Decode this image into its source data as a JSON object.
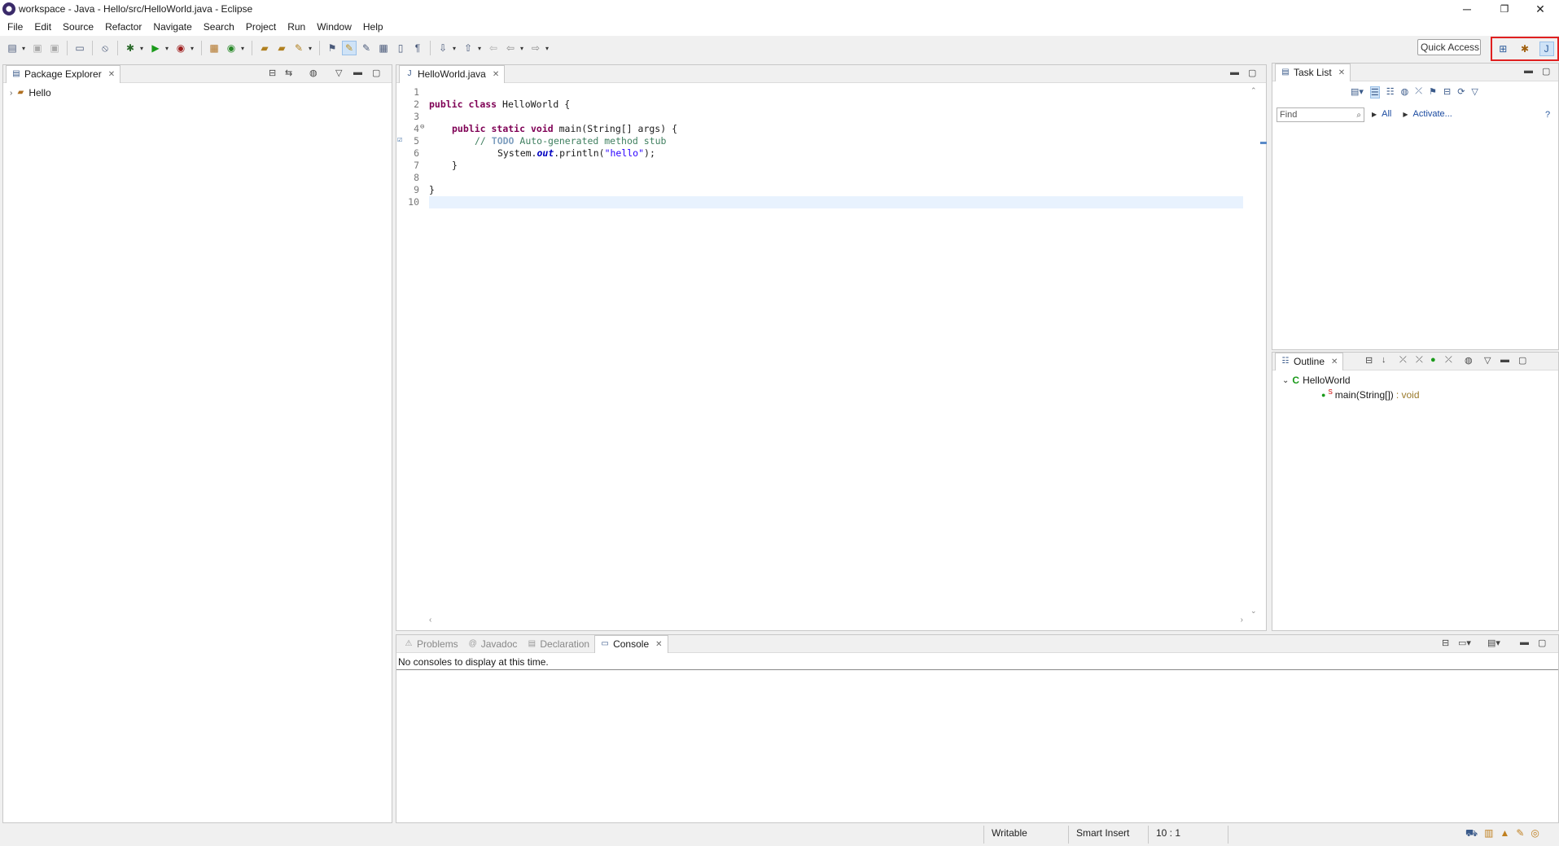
{
  "window": {
    "title": "workspace - Java - Hello/src/HelloWorld.java - Eclipse",
    "minimize": "─",
    "restore": "❐",
    "close": "✕"
  },
  "menu": [
    "File",
    "Edit",
    "Source",
    "Refactor",
    "Navigate",
    "Search",
    "Project",
    "Run",
    "Window",
    "Help"
  ],
  "toolbar": {
    "quick_access": "Quick Access"
  },
  "package_explorer": {
    "tab_label": "Package Explorer",
    "projects": [
      "Hello"
    ]
  },
  "editor": {
    "tab_label": "HelloWorld.java",
    "line_numbers": [
      "1",
      "2",
      "3",
      "4",
      "5",
      "6",
      "7",
      "8",
      "9",
      "10"
    ],
    "code": {
      "l2_kw1": "public",
      "l2_kw2": "class",
      "l2_rest": " HelloWorld {",
      "l4_kw1": "public",
      "l4_kw2": "static",
      "l4_kw3": "void",
      "l4_rest": " main(String[] args) {",
      "l5_comment_start": "// ",
      "l5_todo": "TODO",
      "l5_comment_end": " Auto-generated method stub",
      "l6_a": "System.",
      "l6_static": "out",
      "l6_b": ".println(",
      "l6_str": "\"hello\"",
      "l6_c": ");",
      "l7": "}",
      "l9": "}"
    }
  },
  "task_list": {
    "tab_label": "Task List",
    "find_placeholder": "Find",
    "all_label": "All",
    "activate_label": "Activate..."
  },
  "outline": {
    "tab_label": "Outline",
    "class_name": "HelloWorld",
    "method_name": "main(String[])",
    "method_return": " : void",
    "method_modifier": "S"
  },
  "bottom_panel": {
    "tabs": [
      "Problems",
      "Javadoc",
      "Declaration",
      "Console"
    ],
    "active_tab": "Console",
    "console_message": "No consoles to display at this time."
  },
  "status_bar": {
    "writable": "Writable",
    "insert_mode": "Smart Insert",
    "position": "10 : 1"
  },
  "colors": {
    "keyword": "#7f0055",
    "comment": "#3f7f5f",
    "string": "#2a00ff",
    "highlight_box": "#e02020",
    "current_line": "#e8f2fe"
  }
}
